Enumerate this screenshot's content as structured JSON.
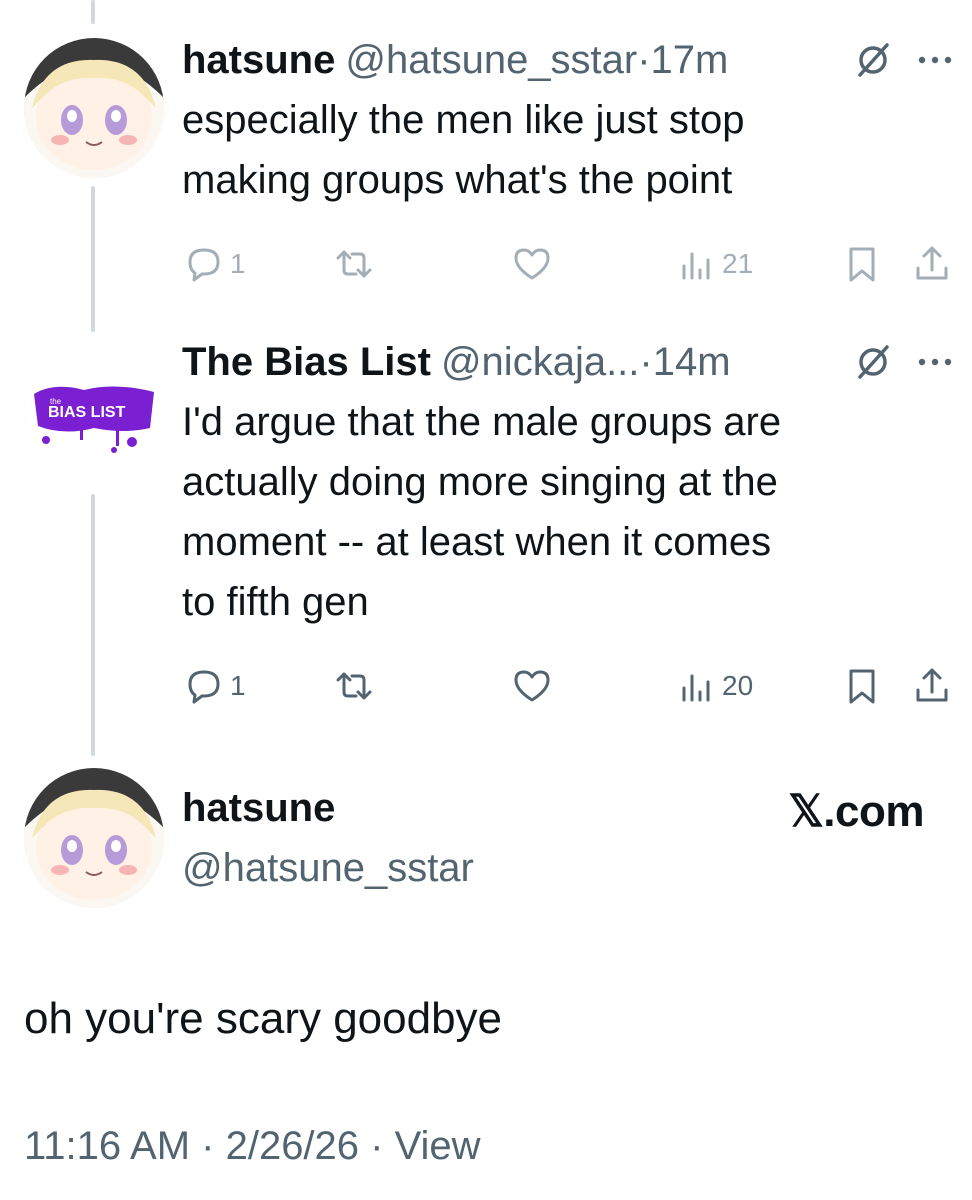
{
  "posts": [
    {
      "name": "hatsune",
      "handle": "@hatsune_sstar",
      "time": "·17m",
      "text_lines": [
        "especially the men like just stop",
        "making groups what's the point"
      ],
      "replies": "1",
      "views": "21"
    },
    {
      "name": "The Bias List",
      "handle": "@nickaja...",
      "time": "·14m",
      "avatar_label_small": "the",
      "avatar_label": "BIAS LIST",
      "text_lines": [
        "I'd argue that the male groups are",
        "actually doing more singing at the",
        "moment -- at least when it comes",
        "to fifth gen"
      ],
      "replies": "1",
      "views": "20"
    }
  ],
  "main_post": {
    "name": "hatsune",
    "handle": "@hatsune_sstar",
    "text": "oh you're scary goodbye",
    "timestamp": "11:16 AM · 2/26/26 · View"
  },
  "brand": {
    "label": "𝕏.com"
  },
  "icons": {
    "reply": "reply-icon",
    "repost": "repost-icon",
    "like": "heart-icon",
    "views": "views-icon",
    "bookmark": "bookmark-icon",
    "share": "share-icon",
    "grok": "grok-icon",
    "more": "more-icon"
  },
  "colors": {
    "text": "#0f1419",
    "secondary": "#536471",
    "faded_icons": "#a4aeb6",
    "thread_line": "#cfd9de",
    "bias_list_purple": "#7a1fd1"
  }
}
